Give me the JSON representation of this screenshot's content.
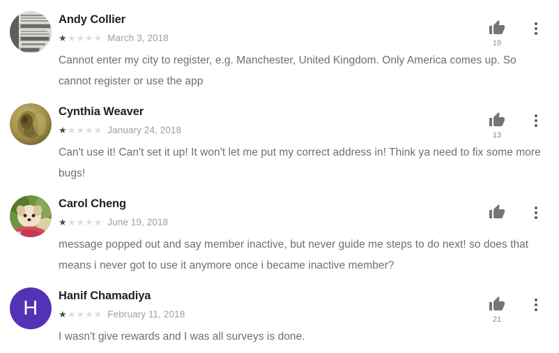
{
  "app": {
    "screen": "Google Play user reviews list"
  },
  "icons": {
    "thumbs_up": "thumb-up-icon",
    "overflow": "more-vert-icon",
    "star_filled": "★",
    "star_empty": "★"
  },
  "reviews": [
    {
      "author": "Andy Collier",
      "rating": 1,
      "max_rating": 5,
      "date": "March 3, 2018",
      "text": "Cannot enter my city to register, e.g. Manchester, United Kingdom. Only America comes up. So cannot register or use the app",
      "helpful_count": "19",
      "avatar": {
        "type": "photo",
        "description": "grayscale photo of a sign with the words HAPPINESS CHOCOLATE KIND",
        "colors": [
          "#9a9a98",
          "#cfcdc8",
          "#5b5b59",
          "#e8e6e1"
        ],
        "initial": "",
        "bg": "#b9b7b2"
      }
    },
    {
      "author": "Cynthia Weaver",
      "rating": 1,
      "max_rating": 5,
      "date": "January 24, 2018",
      "text": "Can't use it! Can't set it up! It won't let me put my correct address in! Think ya need to fix some more bugs!",
      "helpful_count": "13",
      "avatar": {
        "type": "photo",
        "description": "sepia toned portrait of a person",
        "colors": [
          "#b9a75e",
          "#8a7436",
          "#5a4a22",
          "#d6c98d"
        ],
        "initial": "",
        "bg": "#a08f4c"
      }
    },
    {
      "author": "Carol Cheng",
      "rating": 1,
      "max_rating": 5,
      "date": "June 19, 2018",
      "text": "message popped out and say member inactive, but never guide me steps to do next! so does that means i never got to use it anymore once i became inactive member?",
      "helpful_count": "",
      "avatar": {
        "type": "photo",
        "description": "small cream coloured dog wearing a pink bandana on green foliage",
        "colors": [
          "#6f9440",
          "#e8d9b8",
          "#d9485f",
          "#f2ead6"
        ],
        "initial": "",
        "bg": "#7ea24a"
      }
    },
    {
      "author": "Hanif Chamadiya",
      "rating": 1,
      "max_rating": 5,
      "date": "February 11, 2018",
      "text": "I wasn't give rewards and I was all surveys is done.",
      "helpful_count": "21",
      "avatar": {
        "type": "letter",
        "description": "purple circle avatar with white letter H",
        "colors": [
          "#5531b5"
        ],
        "initial": "H",
        "bg": "#5531b5"
      }
    }
  ]
}
